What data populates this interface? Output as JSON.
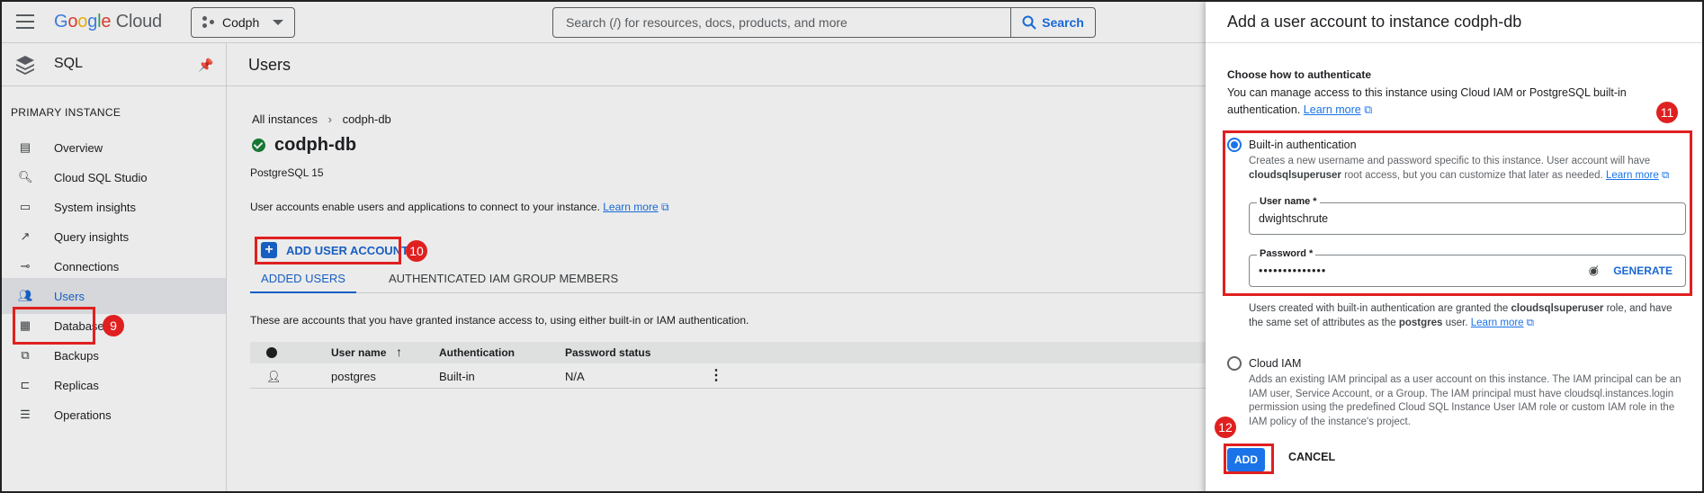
{
  "topbar": {
    "logo_google": "Google",
    "logo_cloud": "Cloud",
    "project": "Codph",
    "search_placeholder": "Search (/) for resources, docs, products, and more",
    "search_button": "Search"
  },
  "sidebar": {
    "product": "SQL",
    "section": "PRIMARY INSTANCE",
    "items": [
      {
        "label": "Overview",
        "icon": "overview-icon"
      },
      {
        "label": "Cloud SQL Studio",
        "icon": "search-icon"
      },
      {
        "label": "System insights",
        "icon": "system-insights-icon"
      },
      {
        "label": "Query insights",
        "icon": "query-insights-icon"
      },
      {
        "label": "Connections",
        "icon": "connections-icon"
      },
      {
        "label": "Users",
        "icon": "users-icon",
        "active": true
      },
      {
        "label": "Databases",
        "icon": "databases-icon"
      },
      {
        "label": "Backups",
        "icon": "backups-icon"
      },
      {
        "label": "Replicas",
        "icon": "replicas-icon"
      },
      {
        "label": "Operations",
        "icon": "operations-icon"
      }
    ]
  },
  "main": {
    "title": "Users",
    "breadcrumb_root": "All instances",
    "breadcrumb_current": "codph-db",
    "instance_name": "codph-db",
    "db_version": "PostgreSQL 15",
    "description": "User accounts enable users and applications to connect to your instance.",
    "learn_more": "Learn more",
    "add_user_button": "ADD USER ACCOUNT",
    "tabs": [
      "ADDED USERS",
      "AUTHENTICATED IAM GROUP MEMBERS"
    ],
    "hint": "These are accounts that you have granted instance access to, using either built-in or IAM authentication.",
    "table": {
      "headers": [
        "User name",
        "Authentication",
        "Password status"
      ],
      "rows": [
        {
          "user": "postgres",
          "auth": "Built-in",
          "password_status": "N/A"
        }
      ]
    }
  },
  "panel": {
    "title": "Add a user account to instance codph-db",
    "heading": "Choose how to authenticate",
    "intro": "You can manage access to this instance using Cloud IAM or PostgreSQL built-in authentication.",
    "learn_more": "Learn more",
    "builtin": {
      "title": "Built-in authentication",
      "desc_a": "Creates a new username and password specific to this instance. User account will have",
      "desc_bold": "cloudsqlsuperuser",
      "desc_b": " root access, but you can customize that later as needed.",
      "learn_more": "Learn more",
      "username_label": "User name *",
      "username_value": "dwightschrute",
      "password_label": "Password *",
      "password_value": "••••••••••••••",
      "generate": "GENERATE",
      "note_a": "Users created with built-in authentication are granted the ",
      "note_bold1": "cloudsqlsuperuser",
      "note_b": " role, and have the same set of attributes as the ",
      "note_bold2": "postgres",
      "note_c": " user.",
      "note_learn": "Learn more"
    },
    "iam": {
      "title": "Cloud IAM",
      "desc": "Adds an existing IAM principal as a user account on this instance. The IAM principal can be an IAM user, Service Account, or a Group. The IAM principal must have cloudsql.instances.login permission using the predefined Cloud SQL Instance User IAM role or custom IAM role in the IAM policy of the instance's project."
    },
    "add_button": "ADD",
    "cancel_button": "CANCEL"
  },
  "annotations": [
    "9",
    "10",
    "11",
    "12"
  ]
}
